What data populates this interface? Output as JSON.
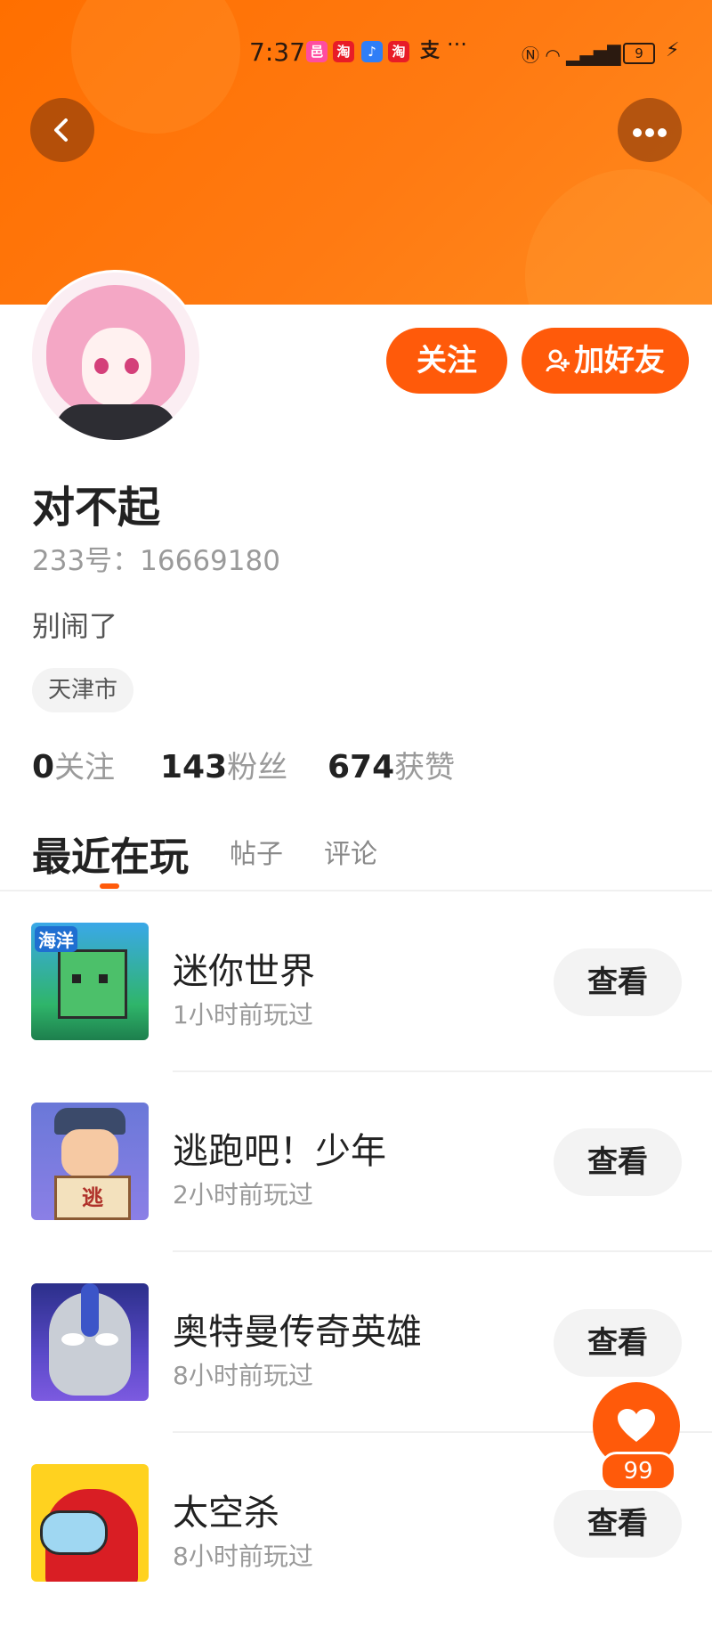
{
  "status_bar": {
    "time": "7:37",
    "battery": "9",
    "notif_icons": [
      "app-icon",
      "taobao-icon",
      "music-icon",
      "taobao-icon",
      "alipay-icon"
    ],
    "more_notifications": "···"
  },
  "header": {
    "back_icon": "chevron-left-icon",
    "more_icon": "more-dots-icon",
    "gradient_colors": [
      "#ff6f00",
      "#ff8a1e"
    ]
  },
  "profile": {
    "name": "对不起",
    "uid": "233号：16669180",
    "bio": "别闹了",
    "location": "天津市",
    "follow_label": "关注",
    "add_friend_label": "加好友",
    "stats": [
      {
        "num": "0",
        "label": "关注"
      },
      {
        "num": "143",
        "label": "粉丝"
      },
      {
        "num": "674",
        "label": "获赞"
      }
    ]
  },
  "tabs": [
    {
      "label": "最近在玩",
      "active": true
    },
    {
      "label": "帖子",
      "active": false
    },
    {
      "label": "评论",
      "active": false
    }
  ],
  "games": [
    {
      "name": "迷你世界",
      "time": "1小时前玩过",
      "button": "查看",
      "icon_tag": "海洋"
    },
    {
      "name": "逃跑吧！少年",
      "time": "2小时前玩过",
      "button": "查看",
      "icon_tag": "逃"
    },
    {
      "name": "奥特曼传奇英雄",
      "time": "8小时前玩过",
      "button": "查看"
    },
    {
      "name": "太空杀",
      "time": "8小时前玩过",
      "button": "查看"
    }
  ],
  "like": {
    "count": "99",
    "icon": "heart-icon"
  },
  "colors": {
    "accent": "#ff5a0a",
    "text_primary": "#222222",
    "text_secondary": "#9a9a9a"
  }
}
